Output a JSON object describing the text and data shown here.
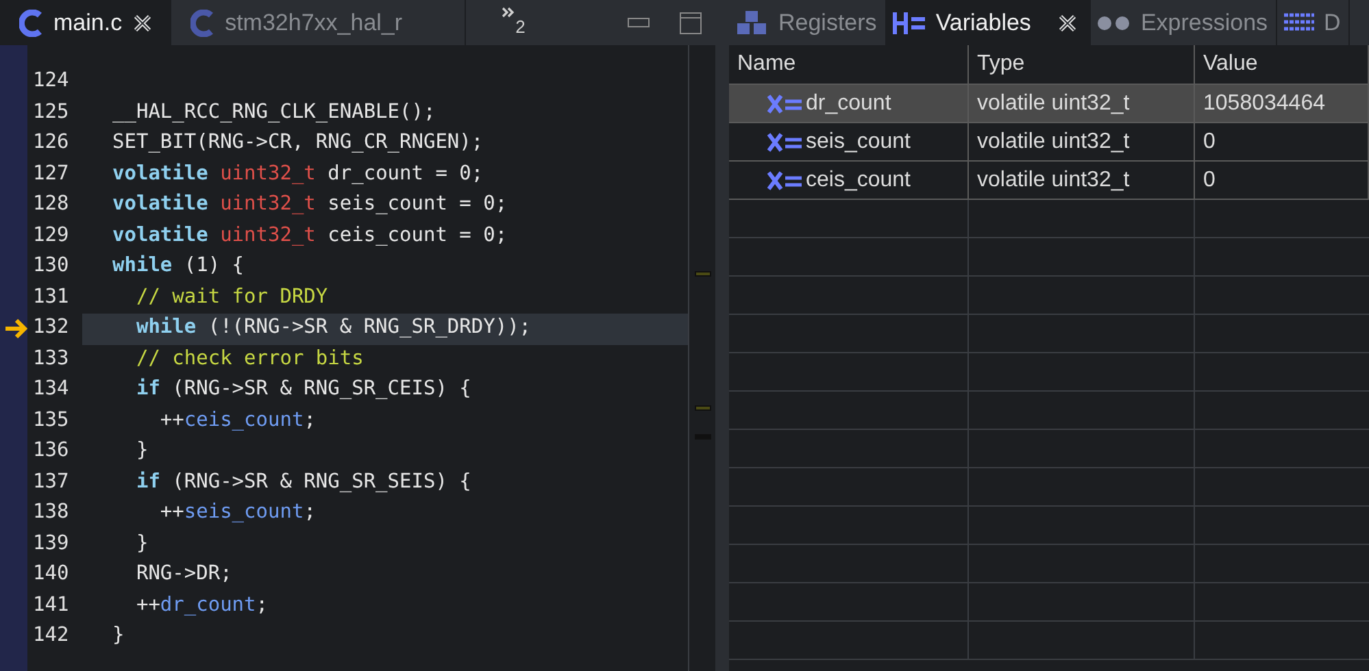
{
  "editor_tabs": [
    {
      "label": "main.c",
      "selected": true,
      "closable": true
    },
    {
      "label": "stm32h7xx_hal_r",
      "selected": false,
      "closable": false
    }
  ],
  "overflow_tab": {
    "label": "2"
  },
  "code": [
    {
      "number": "124",
      "current": false
    },
    {
      "number": "125",
      "current": false,
      "tokens": [
        {
          "kind": "plain",
          "text": "__HAL_RCC_RNG_CLK_ENABLE();"
        }
      ]
    },
    {
      "number": "126",
      "current": false,
      "tokens": [
        {
          "kind": "plain",
          "text": "SET_BIT(RNG->CR, RNG_CR_RNGEN);"
        }
      ]
    },
    {
      "number": "127",
      "current": false,
      "tokens": [
        {
          "kind": "keyword",
          "text": "volatile"
        },
        {
          "kind": "type",
          "text": " uint32_t"
        },
        {
          "kind": "plain",
          "text": " dr_count = 0;"
        }
      ]
    },
    {
      "number": "128",
      "current": false,
      "tokens": [
        {
          "kind": "keyword",
          "text": "volatile"
        },
        {
          "kind": "type",
          "text": " uint32_t"
        },
        {
          "kind": "plain",
          "text": " seis_count = 0;"
        }
      ]
    },
    {
      "number": "129",
      "current": false,
      "tokens": [
        {
          "kind": "keyword",
          "text": "volatile"
        },
        {
          "kind": "type",
          "text": " uint32_t"
        },
        {
          "kind": "plain",
          "text": " ceis_count = 0;"
        }
      ]
    },
    {
      "number": "130",
      "current": false,
      "tokens": [
        {
          "kind": "keyword",
          "text": "while"
        },
        {
          "kind": "plain",
          "text": " (1) {"
        }
      ]
    },
    {
      "number": "131",
      "current": false,
      "tokens": [
        {
          "kind": "comment",
          "text": "  // wait for DRDY"
        }
      ]
    },
    {
      "number": "132",
      "current": true,
      "tokens": [
        {
          "kind": "keyword",
          "text": "  while"
        },
        {
          "kind": "plain",
          "text": " (!(RNG->SR & RNG_SR_DRDY));"
        }
      ]
    },
    {
      "number": "133",
      "current": false,
      "tokens": [
        {
          "kind": "comment",
          "text": "  // check error bits"
        }
      ]
    },
    {
      "number": "134",
      "current": false,
      "tokens": [
        {
          "kind": "keyword",
          "text": "  if"
        },
        {
          "kind": "plain",
          "text": " (RNG->SR & RNG_SR_CEIS) {"
        }
      ]
    },
    {
      "number": "135",
      "current": false,
      "tokens": [
        {
          "kind": "plain",
          "text": "    ++"
        },
        {
          "kind": "variable",
          "text": "ceis_count"
        },
        {
          "kind": "plain",
          "text": ";"
        }
      ]
    },
    {
      "number": "136",
      "current": false,
      "tokens": [
        {
          "kind": "plain",
          "text": "  }"
        }
      ]
    },
    {
      "number": "137",
      "current": false,
      "tokens": [
        {
          "kind": "keyword",
          "text": "  if"
        },
        {
          "kind": "plain",
          "text": " (RNG->SR & RNG_SR_SEIS) {"
        }
      ]
    },
    {
      "number": "138",
      "current": false,
      "tokens": [
        {
          "kind": "plain",
          "text": "    ++"
        },
        {
          "kind": "variable",
          "text": "seis_count"
        },
        {
          "kind": "plain",
          "text": ";"
        }
      ]
    },
    {
      "number": "139",
      "current": false,
      "tokens": [
        {
          "kind": "plain",
          "text": "  }"
        }
      ]
    },
    {
      "number": "140",
      "current": false,
      "tokens": [
        {
          "kind": "plain",
          "text": "  RNG->DR;"
        }
      ]
    },
    {
      "number": "141",
      "current": false,
      "tokens": [
        {
          "kind": "plain",
          "text": "  ++"
        },
        {
          "kind": "variable",
          "text": "dr_count"
        },
        {
          "kind": "plain",
          "text": ";"
        }
      ]
    },
    {
      "number": "142",
      "current": false,
      "tokens": [
        {
          "kind": "plain",
          "text": "}"
        }
      ]
    }
  ],
  "view_tabs": [
    {
      "label": "Registers",
      "selected": false,
      "closable": false
    },
    {
      "label": "Variables",
      "selected": true,
      "closable": true
    },
    {
      "label": "Expressions",
      "selected": false,
      "closable": false
    },
    {
      "label": "D",
      "selected": false,
      "closable": false
    }
  ],
  "table": {
    "columns": [
      "Name",
      "Type",
      "Value"
    ],
    "rows": [
      {
        "name": "dr_count",
        "type": "volatile uint32_t",
        "value": "1058034464",
        "selected": true
      },
      {
        "name": "seis_count",
        "type": "volatile uint32_t",
        "value": "0",
        "selected": false
      },
      {
        "name": "ceis_count",
        "type": "volatile uint32_t",
        "value": "0",
        "selected": false
      }
    ]
  }
}
